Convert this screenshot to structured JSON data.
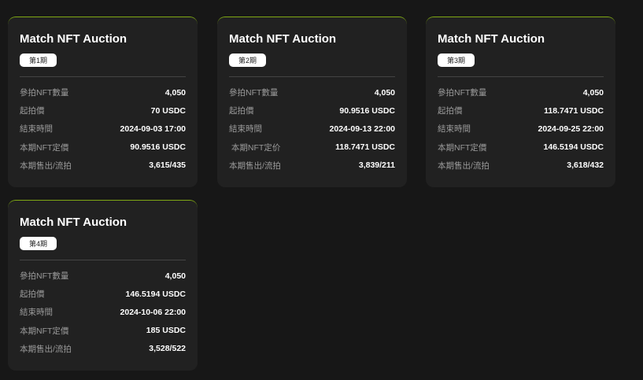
{
  "cards": [
    {
      "title": "Match NFT Auction",
      "period": "第1期",
      "rows": [
        {
          "label": "參拍NFT數量",
          "value": "4,050"
        },
        {
          "label": "起拍價",
          "value": "70 USDC"
        },
        {
          "label": "結束時間",
          "value": "2024-09-03 17:00"
        },
        {
          "label": "本期NFT定價",
          "value": "90.9516 USDC"
        },
        {
          "label": "本期售出/流拍",
          "value": "3,615/435"
        }
      ]
    },
    {
      "title": "Match NFT Auction",
      "period": "第2期",
      "rows": [
        {
          "label": "參拍NFT數量",
          "value": "4,050"
        },
        {
          "label": "起拍價",
          "value": "90.9516 USDC"
        },
        {
          "label": "結束時間",
          "value": "2024-09-13 22:00"
        },
        {
          "label": " 本期NFT定价",
          "value": "118.7471 USDC"
        },
        {
          "label": "本期售出/流拍",
          "value": "3,839/211"
        }
      ]
    },
    {
      "title": "Match NFT Auction",
      "period": "第3期",
      "rows": [
        {
          "label": "參拍NFT數量",
          "value": "4,050"
        },
        {
          "label": "起拍價",
          "value": "118.7471 USDC"
        },
        {
          "label": "結束時間",
          "value": "2024-09-25 22:00"
        },
        {
          "label": "本期NFT定價",
          "value": "146.5194 USDC"
        },
        {
          "label": "本期售出/流拍",
          "value": "3,618/432"
        }
      ]
    },
    {
      "title": "Match NFT Auction",
      "period": "第4期",
      "rows": [
        {
          "label": "參拍NFT數量",
          "value": "4,050"
        },
        {
          "label": "起拍價",
          "value": "146.5194 USDC"
        },
        {
          "label": "結束時間",
          "value": "2024-10-06 22:00"
        },
        {
          "label": "本期NFT定價",
          "value": "185 USDC"
        },
        {
          "label": "本期售出/流拍",
          "value": "3,528/522"
        }
      ]
    }
  ]
}
